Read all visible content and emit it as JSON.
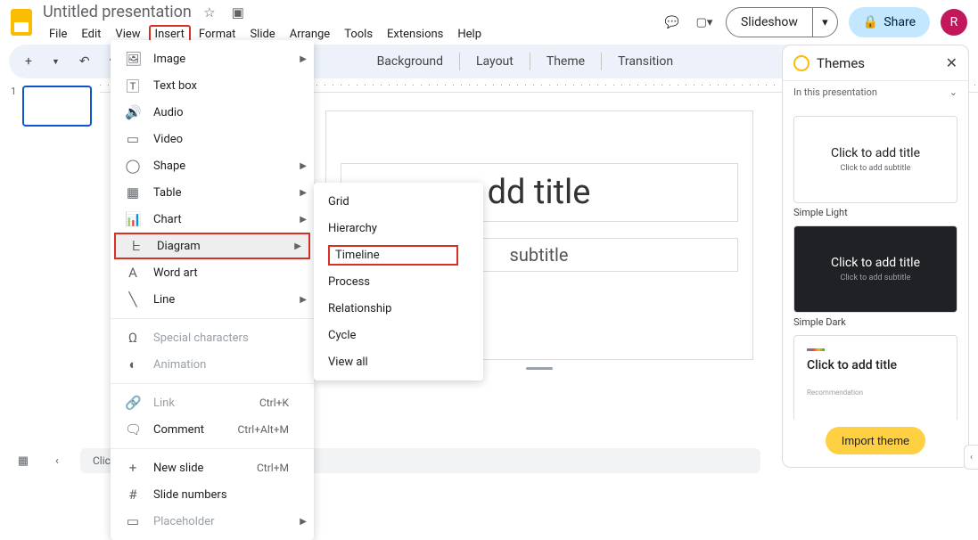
{
  "doc_title": "Untitled presentation",
  "menubar": {
    "file": "File",
    "edit": "Edit",
    "view": "View",
    "insert": "Insert",
    "format": "Format",
    "slide": "Slide",
    "arrange": "Arrange",
    "tools": "Tools",
    "extensions": "Extensions",
    "help": "Help"
  },
  "header_buttons": {
    "slideshow": "Slideshow",
    "share": "Share",
    "avatar": "R"
  },
  "toolbar": {
    "background": "Background",
    "layout": "Layout",
    "theme": "Theme",
    "transition": "Transition"
  },
  "filmstrip": {
    "num": "1"
  },
  "slide": {
    "title": "dd title",
    "subtitle": "subtitle"
  },
  "insert_menu": {
    "image": "Image",
    "textbox": "Text box",
    "audio": "Audio",
    "video": "Video",
    "shape": "Shape",
    "table": "Table",
    "chart": "Chart",
    "diagram": "Diagram",
    "wordart": "Word art",
    "line": "Line",
    "special": "Special characters",
    "animation": "Animation",
    "link": "Link",
    "link_sc": "Ctrl+K",
    "comment": "Comment",
    "comment_sc": "Ctrl+Alt+M",
    "newslide": "New slide",
    "newslide_sc": "Ctrl+M",
    "slidenums": "Slide numbers",
    "placeholder": "Placeholder"
  },
  "diagram_sub": {
    "grid": "Grid",
    "hierarchy": "Hierarchy",
    "timeline": "Timeline",
    "process": "Process",
    "relationship": "Relationship",
    "cycle": "Cycle",
    "viewall": "View all"
  },
  "themes_panel": {
    "title": "Themes",
    "sub": "In this presentation",
    "t1_title": "Click to add title",
    "t1_sub": "Click to add subtitle",
    "t1_name": "Simple Light",
    "t2_title": "Click to add title",
    "t2_sub": "Click to add subtitle",
    "t2_name": "Simple Dark",
    "t3_title": "Click to add title",
    "t3_sub": "Recommendation",
    "import": "Import theme"
  },
  "notes": "Click to add speaker notes"
}
